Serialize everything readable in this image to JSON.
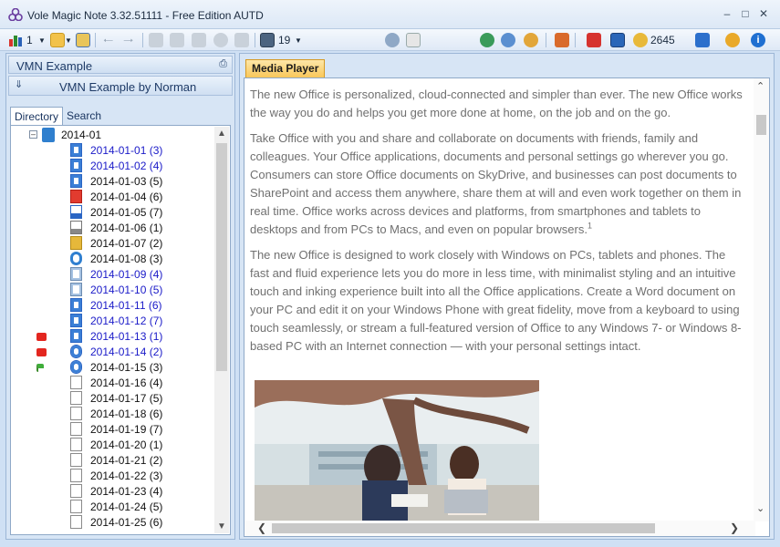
{
  "window": {
    "title": "Vole Magic Note  3.32.51111 - Free Edition AUTD",
    "controls": [
      "minimize",
      "maximize",
      "close"
    ]
  },
  "toolbar": {
    "level_count": "1",
    "page_count": "19",
    "coin_count": "2645"
  },
  "left_panel": {
    "header": "VMN Example",
    "notebook": "VMN Example by Norman",
    "tabs": [
      "Directory",
      "Search"
    ],
    "tree_root": "2014-01",
    "nodes": [
      {
        "label": "2014-01-01 (3)",
        "color": "#1a1ac8",
        "icon": "blue-doc-icon",
        "marker": ""
      },
      {
        "label": "2014-01-02 (4)",
        "color": "#1a1ac8",
        "icon": "blue-doc-icon",
        "marker": ""
      },
      {
        "label": "2014-01-03 (5)",
        "color": "#111111",
        "icon": "blue-doc-icon",
        "marker": ""
      },
      {
        "label": "2014-01-04 (6)",
        "color": "#111111",
        "icon": "youtube-icon",
        "marker": ""
      },
      {
        "label": "2014-01-05 (7)",
        "color": "#111111",
        "icon": "word-doc-icon",
        "marker": ""
      },
      {
        "label": "2014-01-06 (1)",
        "color": "#111111",
        "icon": "pdf-icon",
        "marker": ""
      },
      {
        "label": "2014-01-07 (2)",
        "color": "#111111",
        "icon": "zip-icon",
        "marker": ""
      },
      {
        "label": "2014-01-08 (3)",
        "color": "#111111",
        "icon": "ie-icon",
        "marker": ""
      },
      {
        "label": "2014-01-09 (4)",
        "color": "#1a1ac8",
        "icon": "edit-doc-icon",
        "marker": ""
      },
      {
        "label": "2014-01-10 (5)",
        "color": "#1a1ac8",
        "icon": "edit-doc-icon",
        "marker": ""
      },
      {
        "label": "2014-01-11 (6)",
        "color": "#1a1ac8",
        "icon": "blue-doc-icon",
        "marker": ""
      },
      {
        "label": "2014-01-12 (7)",
        "color": "#1a1ac8",
        "icon": "blue-doc-icon",
        "marker": ""
      },
      {
        "label": "2014-01-13 (1)",
        "color": "#1a1ac8",
        "icon": "blue-doc-icon",
        "marker": "red-dice-icon"
      },
      {
        "label": "2014-01-14 (2)",
        "color": "#1a1ac8",
        "icon": "media-icon",
        "marker": "red-dice-icon"
      },
      {
        "label": "2014-01-15 (3)",
        "color": "#111111",
        "icon": "media-icon",
        "marker": "green-flag-icon"
      },
      {
        "label": "2014-01-16 (4)",
        "color": "#111111",
        "icon": "page-icon",
        "marker": ""
      },
      {
        "label": "2014-01-17 (5)",
        "color": "#111111",
        "icon": "page-icon",
        "marker": ""
      },
      {
        "label": "2014-01-18 (6)",
        "color": "#111111",
        "icon": "page-icon",
        "marker": ""
      },
      {
        "label": "2014-01-19 (7)",
        "color": "#111111",
        "icon": "page-icon",
        "marker": ""
      },
      {
        "label": "2014-01-20 (1)",
        "color": "#111111",
        "icon": "page-icon",
        "marker": ""
      },
      {
        "label": "2014-01-21 (2)",
        "color": "#111111",
        "icon": "page-icon",
        "marker": ""
      },
      {
        "label": "2014-01-22 (3)",
        "color": "#111111",
        "icon": "page-icon",
        "marker": ""
      },
      {
        "label": "2014-01-23 (4)",
        "color": "#111111",
        "icon": "page-icon",
        "marker": ""
      },
      {
        "label": "2014-01-24 (5)",
        "color": "#111111",
        "icon": "page-icon",
        "marker": ""
      },
      {
        "label": "2014-01-25 (6)",
        "color": "#111111",
        "icon": "page-icon",
        "marker": ""
      }
    ]
  },
  "right_panel": {
    "tab": "Media Player",
    "paragraphs": [
      "The new Office is personalized, cloud-connected and simpler than ever. The new Office works the way you do and helps you get more done at home, on the job and on the go.",
      "Take Office with you and share and collaborate on documents with friends, family and colleagues. Your Office applications, documents and personal settings go wherever you go. Consumers can store Office documents on SkyDrive, and businesses can post documents to SharePoint and access them anywhere, share them at will and even work together on them in real time. Office works across devices and platforms, from smartphones and tablets to desktops and from PCs to Macs, and even on popular browsers.",
      "The new Office is designed to work closely with Windows on PCs, tablets and phones. The fast and fluid experience lets you do more in less time, with minimalist styling and an intuitive touch and inking experience built into all the Office applications. Create a Word document on your PC and edit it on your Windows Phone with great fidelity, move from a keyboard to using touch seamlessly, or stream a full-featured version of Office to any Windows 7- or Windows 8-based PC with an Internet connection — with your personal settings intact."
    ],
    "footnote_mark": "1"
  }
}
